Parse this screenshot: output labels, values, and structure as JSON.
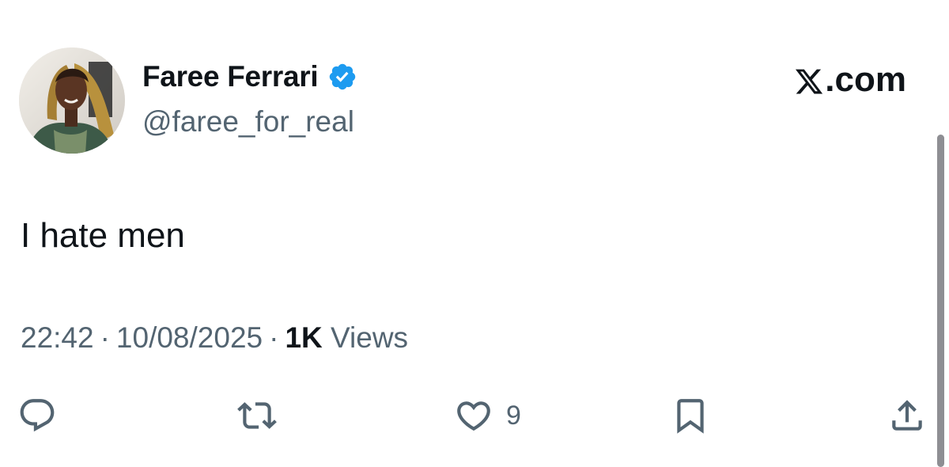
{
  "author": {
    "display_name": "Faree Ferrari",
    "handle": "@faree_for_real",
    "verified": true
  },
  "brand": {
    "label": ".com",
    "logo_icon": "x-logo-icon"
  },
  "tweet": {
    "text": "I hate men",
    "time": "22:42",
    "date": "10/08/2025",
    "views_count": "1K",
    "views_label": "Views",
    "separator": "·"
  },
  "actions": {
    "reply_icon": "reply-icon",
    "retweet_icon": "retweet-icon",
    "like_icon": "heart-icon",
    "like_count": "9",
    "bookmark_icon": "bookmark-icon",
    "share_icon": "share-icon"
  },
  "colors": {
    "text_primary": "#0f1419",
    "text_secondary": "#536471",
    "verified_blue": "#1d9bf0"
  }
}
